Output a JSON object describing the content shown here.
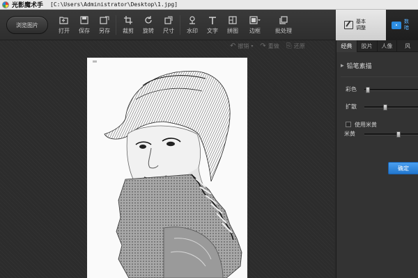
{
  "app": {
    "name": "光影魔术手",
    "file_path": "[C:\\Users\\Administrator\\Desktop\\1.jpg]"
  },
  "toolbar": {
    "browse_label": "浏览图片",
    "tools": [
      {
        "label": "打开",
        "icon": "open-icon"
      },
      {
        "label": "保存",
        "icon": "save-icon"
      },
      {
        "label": "另存",
        "icon": "save-as-icon"
      },
      {
        "label": "裁剪",
        "icon": "crop-icon"
      },
      {
        "label": "旋转",
        "icon": "rotate-icon"
      },
      {
        "label": "尺寸",
        "icon": "resize-icon"
      },
      {
        "label": "水印",
        "icon": "watermark-icon"
      },
      {
        "label": "文字",
        "icon": "text-icon"
      },
      {
        "label": "拼图",
        "icon": "collage-icon"
      },
      {
        "label": "边框",
        "icon": "border-icon"
      },
      {
        "label": "批处理",
        "icon": "batch-icon"
      }
    ]
  },
  "history": {
    "undo_label": "撤销",
    "redo_label": "重做",
    "restore_label": "还原"
  },
  "side_tabs": {
    "basic_line1": "基本",
    "basic_line2": "调整",
    "digital_line1": "数",
    "digital_line2": "暗"
  },
  "panel": {
    "tabs": [
      "经典",
      "胶片",
      "人像",
      "风"
    ],
    "effect_title": "铅笔素描",
    "sliders": [
      {
        "label": "彩色",
        "value": 0.03
      },
      {
        "label": "扩散",
        "value": 0.38
      }
    ],
    "checkbox_label": "使用米黄",
    "checkbox_checked": false,
    "yellow_slider": {
      "label": "米黄",
      "value": 0.66
    },
    "confirm_label": "确定"
  },
  "colors": {
    "accent": "#2a8be0",
    "canvas_bg": "#2c2c2c",
    "panel_bg": "#333333"
  }
}
